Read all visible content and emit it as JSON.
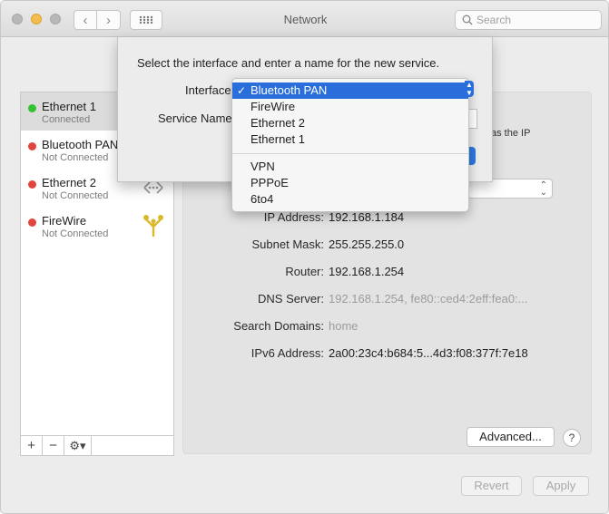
{
  "window": {
    "title": "Network"
  },
  "search": {
    "placeholder": "Search"
  },
  "services": [
    {
      "name": "Ethernet 1",
      "status": "Connected",
      "status_color": "#34c132",
      "selected": true,
      "icon": ""
    },
    {
      "name": "Bluetooth PAN",
      "status": "Not Connected",
      "status_color": "#e0463e",
      "selected": false,
      "icon": ""
    },
    {
      "name": "Ethernet 2",
      "status": "Not Connected",
      "status_color": "#e0463e",
      "selected": false,
      "icon": "ethernet-icon"
    },
    {
      "name": "FireWire",
      "status": "Not Connected",
      "status_color": "#e0463e",
      "selected": false,
      "icon": "firewire-icon"
    }
  ],
  "sidebar_tools": {
    "add": "+",
    "remove": "−",
    "gear": "⚙▾"
  },
  "details": {
    "ip_label": "IP Address:",
    "ip_value": "192.168.1.184",
    "subnet_label": "Subnet Mask:",
    "subnet_value": "255.255.255.0",
    "router_label": "Router:",
    "router_value": "192.168.1.254",
    "dns_label": "DNS Server:",
    "dns_value": "192.168.1.254, fe80::ced4:2eff:fea0:...",
    "domains_label": "Search Domains:",
    "domains_value": "home",
    "ipv6_label": "IPv6 Address:",
    "ipv6_value": "2a00:23c4:b684:5...4d3:f08:377f:7e18",
    "partial_text": "as the IP"
  },
  "buttons": {
    "advanced": "Advanced...",
    "help": "?",
    "revert": "Revert",
    "apply": "Apply"
  },
  "sheet": {
    "prompt": "Select the interface and enter a name for the new service.",
    "interface_label": "Interface",
    "service_name_label": "Service Name"
  },
  "dropdown": {
    "selected": "Bluetooth PAN",
    "group1": [
      "FireWire",
      "Ethernet 2",
      "Ethernet 1"
    ],
    "group2": [
      "VPN",
      "PPPoE",
      "6to4"
    ]
  },
  "colors": {
    "accent": "#2a6edb",
    "connected": "#34c132",
    "disconnected": "#e0463e"
  }
}
